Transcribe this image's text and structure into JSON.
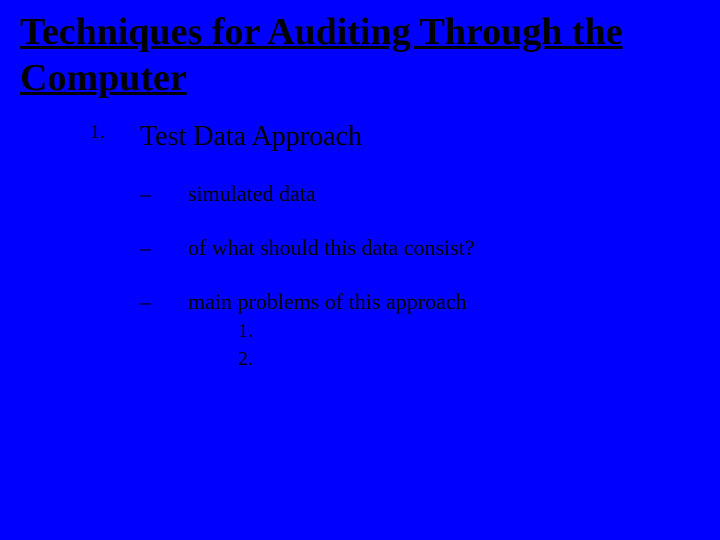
{
  "title": "Techniques for Auditing Through the Computer",
  "item1": {
    "num": "1.",
    "label": "Test Data Approach"
  },
  "sub": {
    "a": {
      "bullet": "–",
      "text": "simulated data"
    },
    "b": {
      "bullet": "–",
      "text": "of what should this data consist?"
    },
    "c": {
      "bullet": "–",
      "text": "main problems of this approach"
    }
  },
  "subsub": {
    "one": "1.",
    "two": "2."
  }
}
